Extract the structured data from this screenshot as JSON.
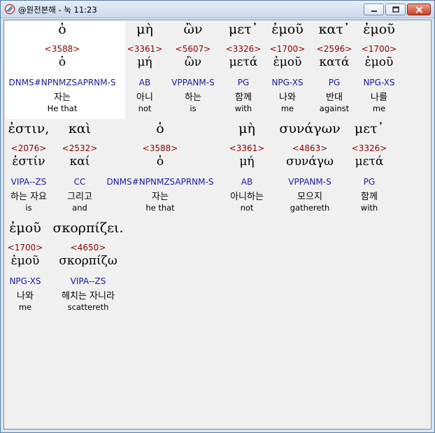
{
  "window": {
    "title": "@원전본해 - 눅 11:23"
  },
  "controls": {
    "minimize": "minimize",
    "maximize": "maximize",
    "close": "close"
  },
  "rows": [
    [
      {
        "greek": "ὁ",
        "strong": "<3588>",
        "lemma": "ὁ",
        "morph": "DNMS#NPNMZSAPRNM-S",
        "korean": "자는",
        "english": "He that"
      },
      {
        "greek": "μὴ",
        "strong": "<3361>",
        "lemma": "μή",
        "morph": "AB",
        "korean": "아니",
        "english": "not"
      },
      {
        "greek": "ὢν",
        "strong": "<5607>",
        "lemma": "ὢν",
        "morph": "VPPANM-S",
        "korean": "하는",
        "english": "is"
      },
      {
        "greek": "μετ᾽",
        "strong": "<3326>",
        "lemma": "μετά",
        "morph": "PG",
        "korean": "함께",
        "english": "with"
      },
      {
        "greek": "ἐμοῦ",
        "strong": "<1700>",
        "lemma": "ἐμοῦ",
        "morph": "NPG-XS",
        "korean": "나와",
        "english": "me"
      },
      {
        "greek": "κατ᾽",
        "strong": "<2596>",
        "lemma": "κατά",
        "morph": "PG",
        "korean": "반대",
        "english": "against"
      },
      {
        "greek": "ἐμοῦ",
        "strong": "<1700>",
        "lemma": "ἐμοῦ",
        "morph": "NPG-XS",
        "korean": "나를",
        "english": "me"
      }
    ],
    [
      {
        "greek": "ἐστιν,",
        "strong": "<2076>",
        "lemma": "ἐστίν",
        "morph": "VIPA--ZS",
        "korean": "하는 자요",
        "english": "is"
      },
      {
        "greek": "καὶ",
        "strong": "<2532>",
        "lemma": "καί",
        "morph": "CC",
        "korean": "그리고",
        "english": "and"
      },
      {
        "greek": "ὁ",
        "strong": "<3588>",
        "lemma": "ὁ",
        "morph": "DNMS#NPNMZSAPRNM-S",
        "korean": "자는",
        "english": "he that"
      },
      {
        "greek": "μὴ",
        "strong": "<3361>",
        "lemma": "μή",
        "morph": "AB",
        "korean": "아니하는",
        "english": "not"
      },
      {
        "greek": "συνάγων",
        "strong": "<4863>",
        "lemma": "συνάγω",
        "morph": "VPPANM-S",
        "korean": "모으지",
        "english": "gathereth"
      },
      {
        "greek": "μετ᾽",
        "strong": "<3326>",
        "lemma": "μετά",
        "morph": "PG",
        "korean": "함께",
        "english": "with"
      }
    ],
    [
      {
        "greek": "ἐμοῦ",
        "strong": "<1700>",
        "lemma": "ἐμοῦ",
        "morph": "NPG-XS",
        "korean": "나와",
        "english": "me"
      },
      {
        "greek": "σκορπίζει.",
        "strong": "<4650>",
        "lemma": "σκορπίζω",
        "morph": "VIPA--ZS",
        "korean": "헤치는 자니라",
        "english": "scattereth"
      }
    ]
  ]
}
